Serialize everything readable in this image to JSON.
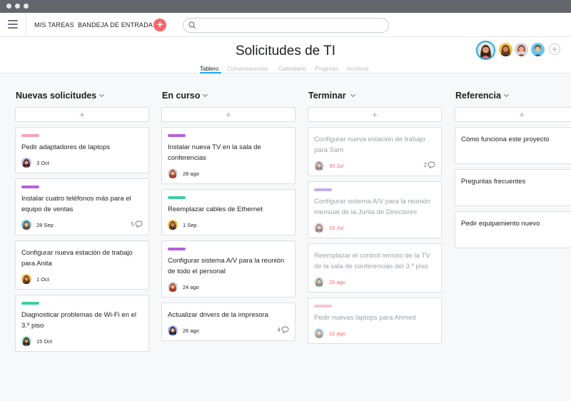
{
  "topbar": {
    "nav": [
      "MIS TAREAS",
      "BANDEJA DE ENTRADA"
    ],
    "add_label": "+"
  },
  "project": {
    "title": "Solicitudes de TI",
    "tabs": [
      "Tablero",
      "Conversaciones",
      "Calendario",
      "Progreso",
      "Archivos"
    ],
    "active_tab": "Tablero",
    "members_add_label": "+"
  },
  "colors": {
    "accent": "#14aaf5",
    "add_button": "#fc636b",
    "tag_pink": "#f7a1bd",
    "tag_purple": "#b65fd9",
    "tag_teal": "#3dcea5",
    "tag_lavender": "#c0b0ef",
    "tag_light_pink": "#f7c4d2",
    "done_date": "#f06a6a"
  },
  "board": {
    "add_label": "+",
    "columns": [
      {
        "title": "Nuevas solicitudes",
        "cards": [
          {
            "tag": "pink",
            "name": "Pedir adaptadores de laptops",
            "date": "3 Oct",
            "comments": ""
          },
          {
            "tag": "purple",
            "name": "Instalar cuatro teléfonos más para el equipo de ventas",
            "date": "28 Sep",
            "comments": "5"
          },
          {
            "tag": "",
            "name": "Configurar nueva estación de trabajo para Anita",
            "date": "1 Oct",
            "comments": ""
          },
          {
            "tag": "teal",
            "name": "Diagnosticar problemas de Wi-Fi en el 3.º piso",
            "date": "15 Oct",
            "comments": ""
          }
        ]
      },
      {
        "title": "En curso",
        "cards": [
          {
            "tag": "purple",
            "name": "Instalar nueva TV en la sala de conferencias",
            "date": "28 ago",
            "comments": ""
          },
          {
            "tag": "teal",
            "name": "Reemplazar cables de Ethernet",
            "date": "1 Sep",
            "comments": ""
          },
          {
            "tag": "purple",
            "name": "Configurar sistema A/V para la reunión de todo el personal",
            "date": "24 ago",
            "comments": ""
          },
          {
            "tag": "",
            "name": "Actualizar drivers de la impresora",
            "date": "26 ago",
            "comments": "4"
          }
        ]
      },
      {
        "title": "Terminar",
        "cards": [
          {
            "tag": "",
            "name": "Configurar nueva estación de trabajo para Sam",
            "date": "30 Jul",
            "comments": "2"
          },
          {
            "tag": "lavender",
            "name": "Configurar sistema A/V para la reunión mensual de la Junta de Directores",
            "date": "15 Jul",
            "comments": ""
          },
          {
            "tag": "",
            "name": "Reemplazar el control remoto de la TV de la sala de conferencias del 3.º piso",
            "date": "20 ago",
            "comments": ""
          },
          {
            "tag": "light_pink",
            "name": "Pedir nuevas laptops para Ahmed",
            "date": "12 ago",
            "comments": ""
          }
        ]
      },
      {
        "title": "Referencia",
        "cards": [
          {
            "name": "Cómo funciona este proyecto"
          },
          {
            "name": "Preguntas frecuentes"
          },
          {
            "name": "Pedir equipamiento nuevo"
          }
        ]
      }
    ]
  }
}
